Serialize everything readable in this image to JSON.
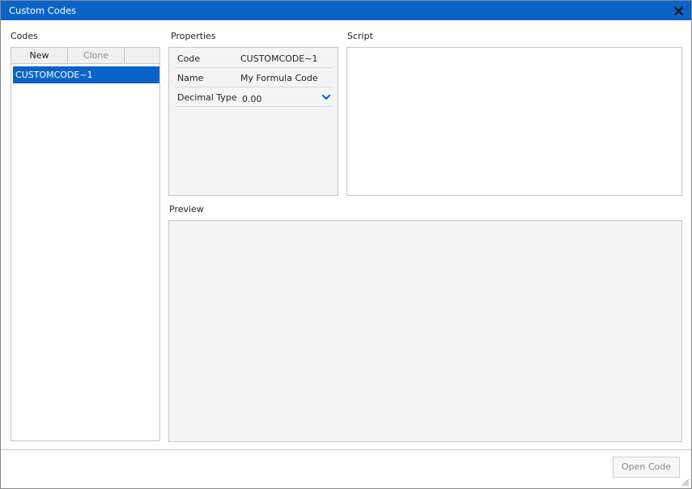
{
  "window": {
    "title": "Custom Codes"
  },
  "codes": {
    "label": "Codes",
    "toolbar": {
      "new_label": "New",
      "clone_label": "Clone"
    },
    "items": [
      {
        "label": "CUSTOMCODE~1",
        "selected": true
      }
    ]
  },
  "properties": {
    "label": "Properties",
    "rows": [
      {
        "key": "Code",
        "value": "CUSTOMCODE~1"
      },
      {
        "key": "Name",
        "value": "My Formula Code"
      },
      {
        "key": "Decimal Type",
        "value": "0.00"
      }
    ]
  },
  "script": {
    "label": "Script"
  },
  "preview": {
    "label": "Preview"
  },
  "footer": {
    "open_code_label": "Open Code"
  },
  "colors": {
    "accent": "#0a64c8",
    "panel_bg": "#f4f4f4",
    "border": "#c8c8c8",
    "disabled_text": "#8a8a8a"
  },
  "icons": {
    "close": "close-icon",
    "dropdown": "chevron-down-icon",
    "resize": "resize-grip-icon"
  }
}
